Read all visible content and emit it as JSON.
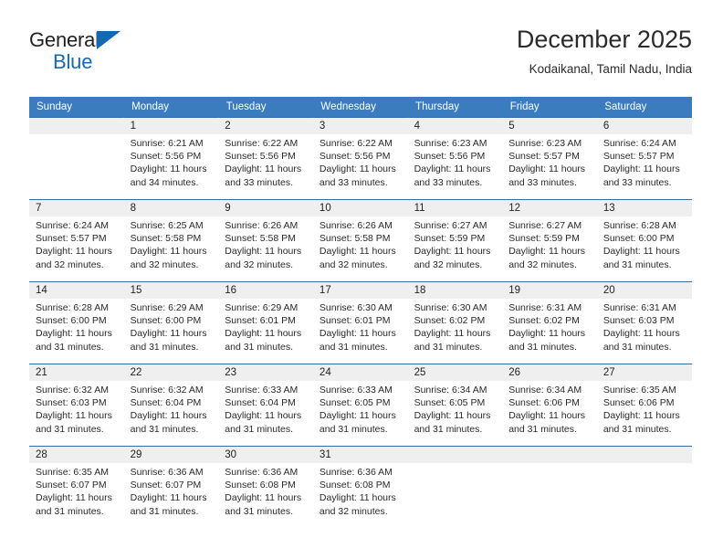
{
  "brand": {
    "name_top": "General",
    "name_bottom": "Blue",
    "accent_color": "#1569b0"
  },
  "header": {
    "month_title": "December 2025",
    "location": "Kodaikanal, Tamil Nadu, India"
  },
  "colors": {
    "header_row_bg": "#3a7cbe",
    "row_border": "#2f6da8",
    "daynum_band_bg": "#efeff0",
    "text": "#222222"
  },
  "weekday_headers": [
    "Sunday",
    "Monday",
    "Tuesday",
    "Wednesday",
    "Thursday",
    "Friday",
    "Saturday"
  ],
  "weeks": [
    [
      {
        "day": "",
        "sunrise": "",
        "sunset": "",
        "daylight_line1": "",
        "daylight_line2": "",
        "empty": true
      },
      {
        "day": "1",
        "sunrise": "Sunrise: 6:21 AM",
        "sunset": "Sunset: 5:56 PM",
        "daylight_line1": "Daylight: 11 hours",
        "daylight_line2": "and 34 minutes."
      },
      {
        "day": "2",
        "sunrise": "Sunrise: 6:22 AM",
        "sunset": "Sunset: 5:56 PM",
        "daylight_line1": "Daylight: 11 hours",
        "daylight_line2": "and 33 minutes."
      },
      {
        "day": "3",
        "sunrise": "Sunrise: 6:22 AM",
        "sunset": "Sunset: 5:56 PM",
        "daylight_line1": "Daylight: 11 hours",
        "daylight_line2": "and 33 minutes."
      },
      {
        "day": "4",
        "sunrise": "Sunrise: 6:23 AM",
        "sunset": "Sunset: 5:56 PM",
        "daylight_line1": "Daylight: 11 hours",
        "daylight_line2": "and 33 minutes."
      },
      {
        "day": "5",
        "sunrise": "Sunrise: 6:23 AM",
        "sunset": "Sunset: 5:57 PM",
        "daylight_line1": "Daylight: 11 hours",
        "daylight_line2": "and 33 minutes."
      },
      {
        "day": "6",
        "sunrise": "Sunrise: 6:24 AM",
        "sunset": "Sunset: 5:57 PM",
        "daylight_line1": "Daylight: 11 hours",
        "daylight_line2": "and 33 minutes."
      }
    ],
    [
      {
        "day": "7",
        "sunrise": "Sunrise: 6:24 AM",
        "sunset": "Sunset: 5:57 PM",
        "daylight_line1": "Daylight: 11 hours",
        "daylight_line2": "and 32 minutes."
      },
      {
        "day": "8",
        "sunrise": "Sunrise: 6:25 AM",
        "sunset": "Sunset: 5:58 PM",
        "daylight_line1": "Daylight: 11 hours",
        "daylight_line2": "and 32 minutes."
      },
      {
        "day": "9",
        "sunrise": "Sunrise: 6:26 AM",
        "sunset": "Sunset: 5:58 PM",
        "daylight_line1": "Daylight: 11 hours",
        "daylight_line2": "and 32 minutes."
      },
      {
        "day": "10",
        "sunrise": "Sunrise: 6:26 AM",
        "sunset": "Sunset: 5:58 PM",
        "daylight_line1": "Daylight: 11 hours",
        "daylight_line2": "and 32 minutes."
      },
      {
        "day": "11",
        "sunrise": "Sunrise: 6:27 AM",
        "sunset": "Sunset: 5:59 PM",
        "daylight_line1": "Daylight: 11 hours",
        "daylight_line2": "and 32 minutes."
      },
      {
        "day": "12",
        "sunrise": "Sunrise: 6:27 AM",
        "sunset": "Sunset: 5:59 PM",
        "daylight_line1": "Daylight: 11 hours",
        "daylight_line2": "and 32 minutes."
      },
      {
        "day": "13",
        "sunrise": "Sunrise: 6:28 AM",
        "sunset": "Sunset: 6:00 PM",
        "daylight_line1": "Daylight: 11 hours",
        "daylight_line2": "and 31 minutes."
      }
    ],
    [
      {
        "day": "14",
        "sunrise": "Sunrise: 6:28 AM",
        "sunset": "Sunset: 6:00 PM",
        "daylight_line1": "Daylight: 11 hours",
        "daylight_line2": "and 31 minutes."
      },
      {
        "day": "15",
        "sunrise": "Sunrise: 6:29 AM",
        "sunset": "Sunset: 6:00 PM",
        "daylight_line1": "Daylight: 11 hours",
        "daylight_line2": "and 31 minutes."
      },
      {
        "day": "16",
        "sunrise": "Sunrise: 6:29 AM",
        "sunset": "Sunset: 6:01 PM",
        "daylight_line1": "Daylight: 11 hours",
        "daylight_line2": "and 31 minutes."
      },
      {
        "day": "17",
        "sunrise": "Sunrise: 6:30 AM",
        "sunset": "Sunset: 6:01 PM",
        "daylight_line1": "Daylight: 11 hours",
        "daylight_line2": "and 31 minutes."
      },
      {
        "day": "18",
        "sunrise": "Sunrise: 6:30 AM",
        "sunset": "Sunset: 6:02 PM",
        "daylight_line1": "Daylight: 11 hours",
        "daylight_line2": "and 31 minutes."
      },
      {
        "day": "19",
        "sunrise": "Sunrise: 6:31 AM",
        "sunset": "Sunset: 6:02 PM",
        "daylight_line1": "Daylight: 11 hours",
        "daylight_line2": "and 31 minutes."
      },
      {
        "day": "20",
        "sunrise": "Sunrise: 6:31 AM",
        "sunset": "Sunset: 6:03 PM",
        "daylight_line1": "Daylight: 11 hours",
        "daylight_line2": "and 31 minutes."
      }
    ],
    [
      {
        "day": "21",
        "sunrise": "Sunrise: 6:32 AM",
        "sunset": "Sunset: 6:03 PM",
        "daylight_line1": "Daylight: 11 hours",
        "daylight_line2": "and 31 minutes."
      },
      {
        "day": "22",
        "sunrise": "Sunrise: 6:32 AM",
        "sunset": "Sunset: 6:04 PM",
        "daylight_line1": "Daylight: 11 hours",
        "daylight_line2": "and 31 minutes."
      },
      {
        "day": "23",
        "sunrise": "Sunrise: 6:33 AM",
        "sunset": "Sunset: 6:04 PM",
        "daylight_line1": "Daylight: 11 hours",
        "daylight_line2": "and 31 minutes."
      },
      {
        "day": "24",
        "sunrise": "Sunrise: 6:33 AM",
        "sunset": "Sunset: 6:05 PM",
        "daylight_line1": "Daylight: 11 hours",
        "daylight_line2": "and 31 minutes."
      },
      {
        "day": "25",
        "sunrise": "Sunrise: 6:34 AM",
        "sunset": "Sunset: 6:05 PM",
        "daylight_line1": "Daylight: 11 hours",
        "daylight_line2": "and 31 minutes."
      },
      {
        "day": "26",
        "sunrise": "Sunrise: 6:34 AM",
        "sunset": "Sunset: 6:06 PM",
        "daylight_line1": "Daylight: 11 hours",
        "daylight_line2": "and 31 minutes."
      },
      {
        "day": "27",
        "sunrise": "Sunrise: 6:35 AM",
        "sunset": "Sunset: 6:06 PM",
        "daylight_line1": "Daylight: 11 hours",
        "daylight_line2": "and 31 minutes."
      }
    ],
    [
      {
        "day": "28",
        "sunrise": "Sunrise: 6:35 AM",
        "sunset": "Sunset: 6:07 PM",
        "daylight_line1": "Daylight: 11 hours",
        "daylight_line2": "and 31 minutes."
      },
      {
        "day": "29",
        "sunrise": "Sunrise: 6:36 AM",
        "sunset": "Sunset: 6:07 PM",
        "daylight_line1": "Daylight: 11 hours",
        "daylight_line2": "and 31 minutes."
      },
      {
        "day": "30",
        "sunrise": "Sunrise: 6:36 AM",
        "sunset": "Sunset: 6:08 PM",
        "daylight_line1": "Daylight: 11 hours",
        "daylight_line2": "and 31 minutes."
      },
      {
        "day": "31",
        "sunrise": "Sunrise: 6:36 AM",
        "sunset": "Sunset: 6:08 PM",
        "daylight_line1": "Daylight: 11 hours",
        "daylight_line2": "and 32 minutes."
      },
      {
        "day": "",
        "sunrise": "",
        "sunset": "",
        "daylight_line1": "",
        "daylight_line2": "",
        "empty": true
      },
      {
        "day": "",
        "sunrise": "",
        "sunset": "",
        "daylight_line1": "",
        "daylight_line2": "",
        "empty": true
      },
      {
        "day": "",
        "sunrise": "",
        "sunset": "",
        "daylight_line1": "",
        "daylight_line2": "",
        "empty": true
      }
    ]
  ]
}
